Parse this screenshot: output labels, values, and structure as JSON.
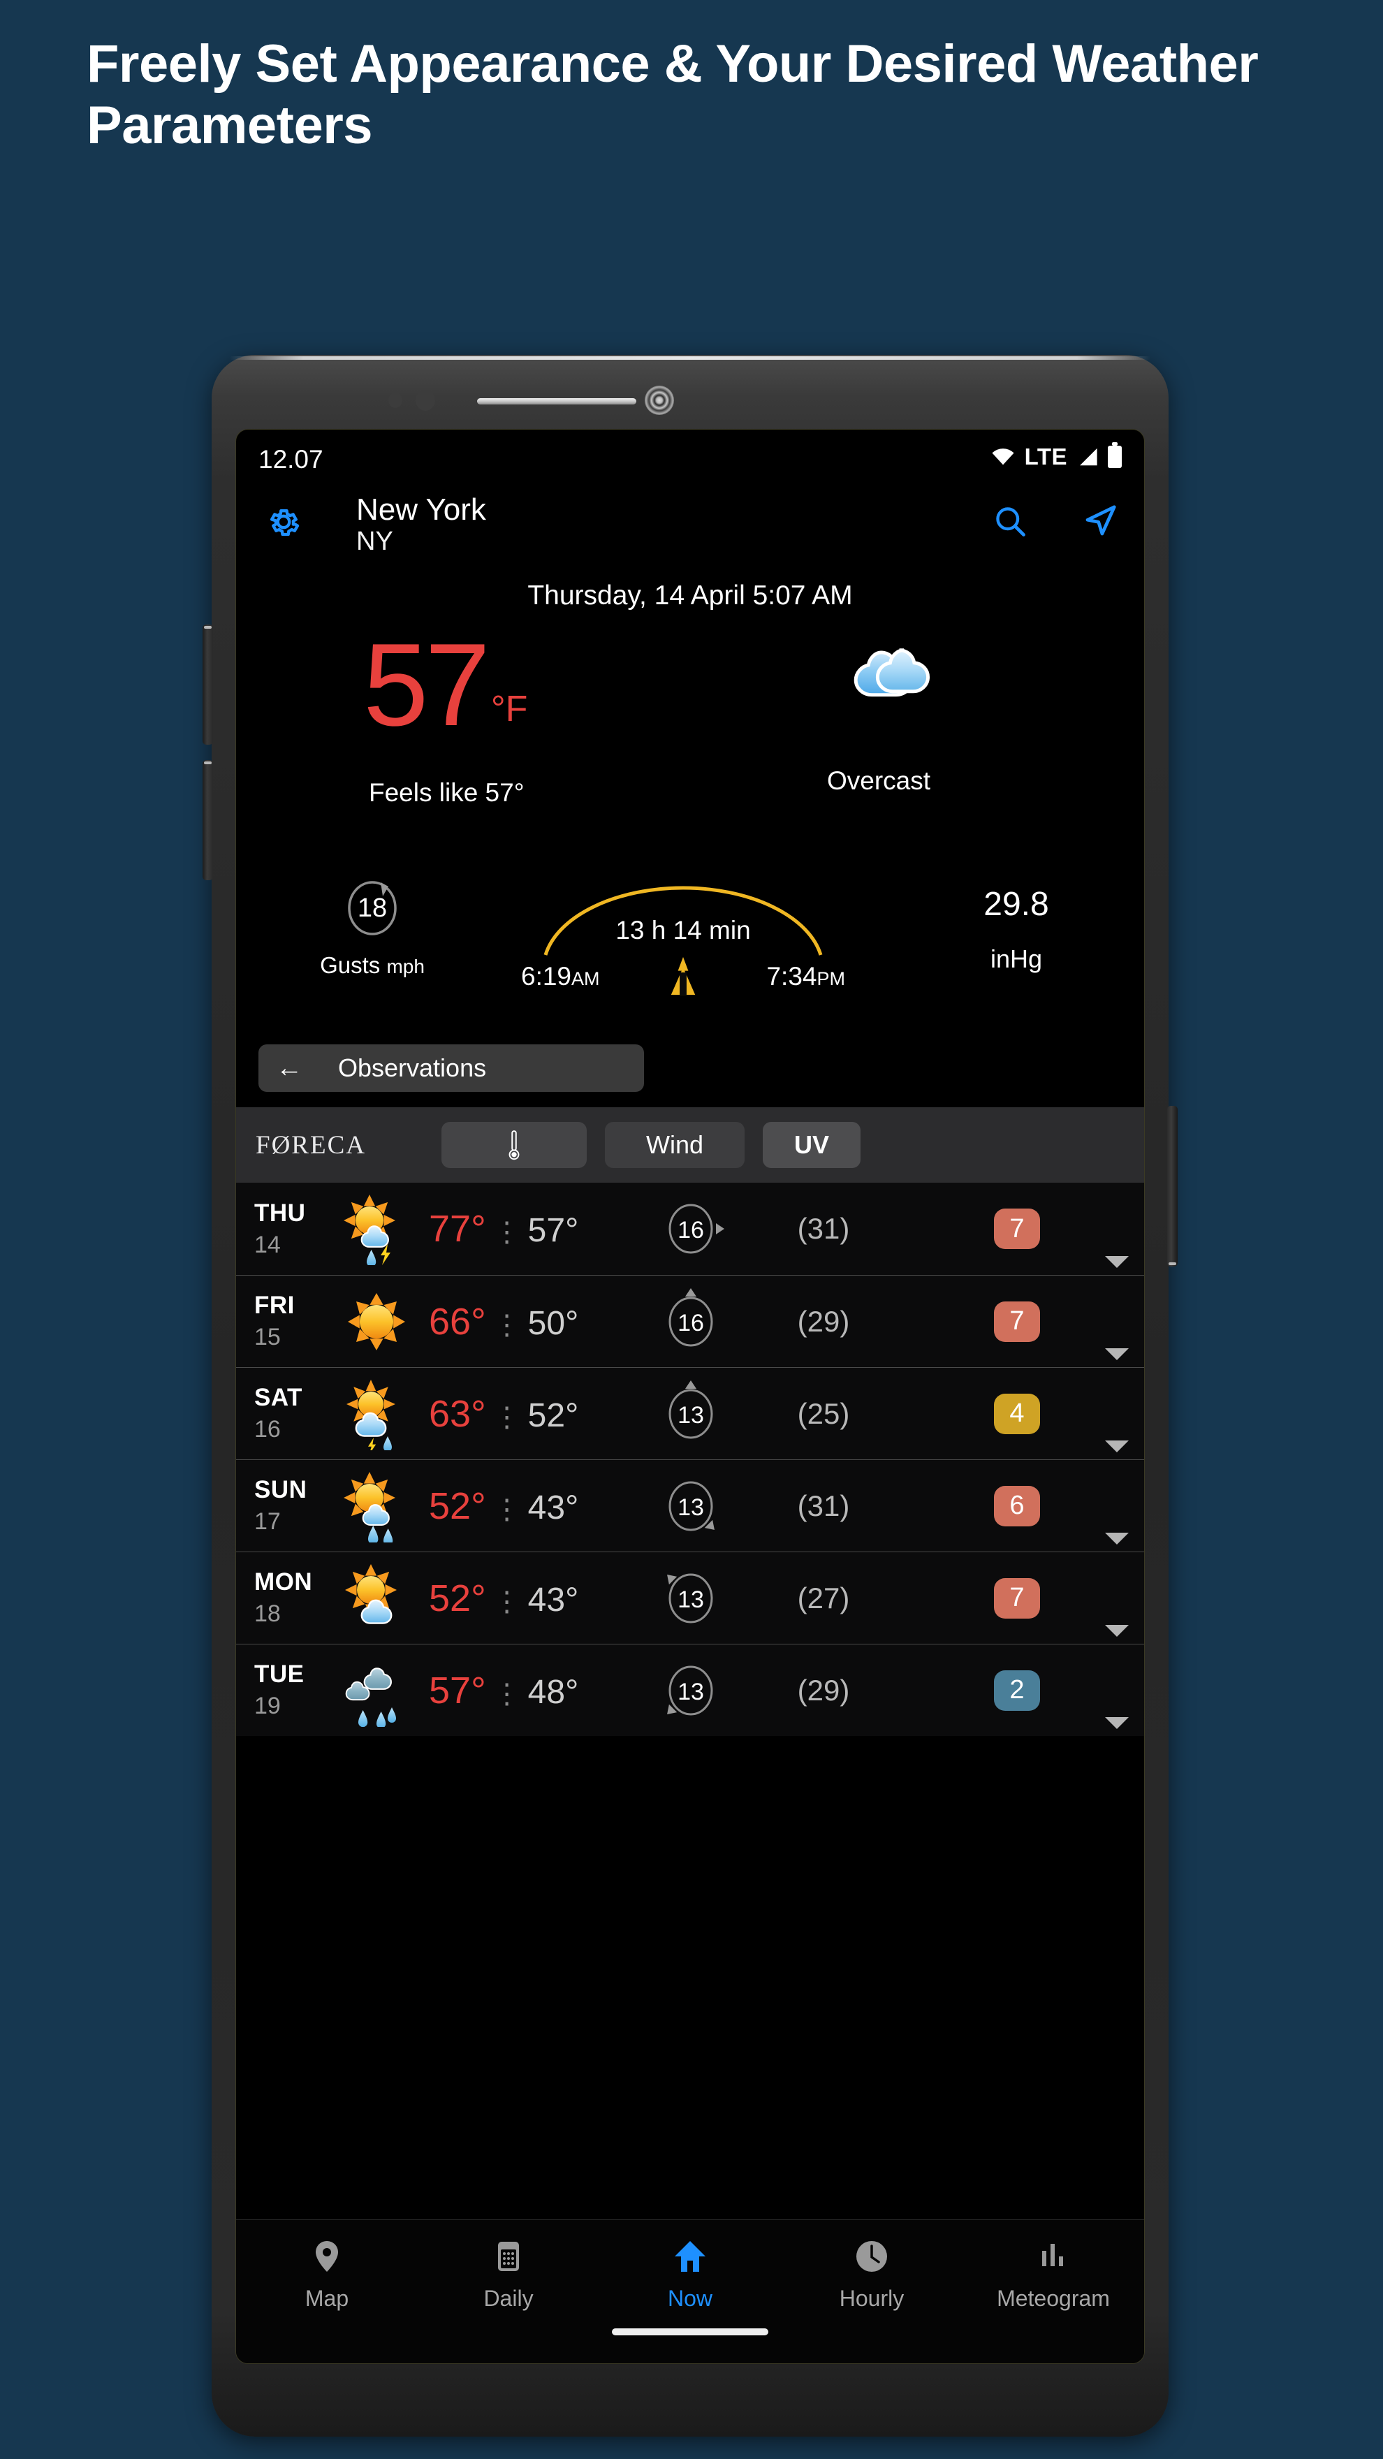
{
  "headline": "Freely Set Appearance & Your Desired Weather Parameters",
  "colors": {
    "background": "#163750",
    "accent": "#1e90ff",
    "hot": "#e8413d",
    "uv_high": "#d1705c",
    "uv_moderate": "#cfa325",
    "uv_low": "#4a7f99"
  },
  "status_bar": {
    "time": "12.07",
    "network": "LTE",
    "wifi_icon": "wifi-icon",
    "signal_icon": "signal-icon",
    "battery_icon": "battery-icon"
  },
  "header": {
    "settings_icon": "gear-icon",
    "city": "New York",
    "region": "NY",
    "search_icon": "search-icon",
    "locate_icon": "navigation-arrow-icon"
  },
  "current": {
    "datetime": "Thursday, 14 April 5:07 AM",
    "temperature": "57",
    "unit": "°F",
    "feels_like": "Feels like 57°",
    "condition": "Overcast",
    "condition_icon": "overcast-clouds-icon"
  },
  "metrics": {
    "gusts_value": "18",
    "gusts_label": "Gusts",
    "gusts_unit": "mph",
    "day_length": "13 h 14 min",
    "sunrise_time": "6:19",
    "sunrise_ampm": "AM",
    "sunset_time": "7:34",
    "sunset_ampm": "PM",
    "sun_icon": "sunrise-sunset-icon",
    "pressure_value": "29.8",
    "pressure_unit": "inHg"
  },
  "observations": {
    "back_icon": "back-arrow-icon",
    "label": "Observations"
  },
  "toolbar": {
    "brand": "FØRECA",
    "temp_tab": "thermometer-icon",
    "wind_tab": "Wind",
    "uv_tab": "UV"
  },
  "forecast": {
    "rows": [
      {
        "day": "THU",
        "date": "14",
        "icon": "sun-thunderstorm-icon",
        "hi": "77°",
        "lo": "57°",
        "wind": "16",
        "wind_dir": 90,
        "gust": "(31)",
        "uv": "7",
        "uv_color": "#d1705c"
      },
      {
        "day": "FRI",
        "date": "15",
        "icon": "sunny-icon",
        "hi": "66°",
        "lo": "50°",
        "wind": "16",
        "wind_dir": 0,
        "gust": "(29)",
        "uv": "7",
        "uv_color": "#d1705c"
      },
      {
        "day": "SAT",
        "date": "16",
        "icon": "sun-cloud-rain-icon",
        "hi": "63°",
        "lo": "52°",
        "wind": "13",
        "wind_dir": 0,
        "gust": "(25)",
        "uv": "4",
        "uv_color": "#cfa325"
      },
      {
        "day": "SUN",
        "date": "17",
        "icon": "sun-rain-icon",
        "hi": "52°",
        "lo": "43°",
        "wind": "13",
        "wind_dir": 135,
        "gust": "(31)",
        "uv": "6",
        "uv_color": "#d1705c"
      },
      {
        "day": "MON",
        "date": "18",
        "icon": "sun-cloud-icon",
        "hi": "52°",
        "lo": "43°",
        "wind": "13",
        "wind_dir": 315,
        "gust": "(27)",
        "uv": "7",
        "uv_color": "#d1705c"
      },
      {
        "day": "TUE",
        "date": "19",
        "icon": "rain-cloud-icon",
        "hi": "57°",
        "lo": "48°",
        "wind": "13",
        "wind_dir": 225,
        "gust": "(29)",
        "uv": "2",
        "uv_color": "#4a7f99"
      }
    ]
  },
  "bottom_nav": {
    "items": [
      {
        "label": "Map",
        "icon": "map-pin-icon",
        "active": false
      },
      {
        "label": "Daily",
        "icon": "calendar-icon",
        "active": false
      },
      {
        "label": "Now",
        "icon": "home-icon",
        "active": true
      },
      {
        "label": "Hourly",
        "icon": "clock-icon",
        "active": false
      },
      {
        "label": "Meteogram",
        "icon": "bar-chart-icon",
        "active": false
      }
    ]
  }
}
